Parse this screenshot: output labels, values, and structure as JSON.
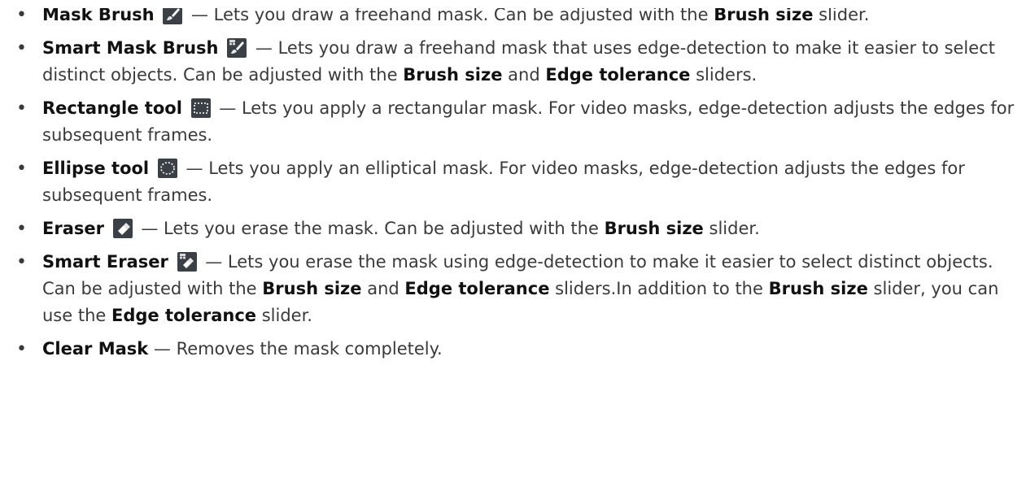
{
  "items": [
    {
      "title": "Mask Brush",
      "icon": "mask-brush-icon",
      "dash": "—",
      "text1": "Lets you draw a freehand mask. Can be adjusted with the",
      "bold1": "Brush size",
      "text2": "slider."
    },
    {
      "title": "Smart Mask Brush",
      "icon": "smart-mask-brush-icon",
      "dash": "—",
      "text1": "Lets you draw a freehand mask that uses edge-detection to make it easier to select distinct objects. Can be adjusted with the",
      "bold1": "Brush size",
      "text2": "and",
      "bold2": "Edge tolerance",
      "text3": "sliders."
    },
    {
      "title": "Rectangle tool",
      "icon": "rectangle-tool-icon",
      "dash": "—",
      "text1": "Lets you apply a rectangular mask. For video masks, edge-detection adjusts the edges for subsequent frames."
    },
    {
      "title": "Ellipse tool",
      "icon": "ellipse-tool-icon",
      "dash": "—",
      "text1": "Lets you apply an elliptical mask. For video masks, edge-detection adjusts the edges for subsequent frames."
    },
    {
      "title": "Eraser",
      "icon": "eraser-icon",
      "dash": "—",
      "text1": "Lets you erase the mask. Can be adjusted with the",
      "bold1": "Brush size",
      "text2": "slider."
    },
    {
      "title": "Smart Eraser",
      "icon": "smart-eraser-icon",
      "dash": "—",
      "text1": "Lets you erase the mask using edge-detection to make it easier to select distinct objects. Can be adjusted with the",
      "bold1": "Brush size",
      "text2": "and",
      "bold2": "Edge tolerance",
      "text3": "sliders.In addition to the",
      "bold3": "Brush size",
      "text4": "slider, you can use the",
      "bold4": "Edge tolerance",
      "text5": "slider."
    },
    {
      "title": "Clear Mask",
      "dash": "—",
      "text1": "Removes the mask completely."
    }
  ],
  "bullet": "•"
}
